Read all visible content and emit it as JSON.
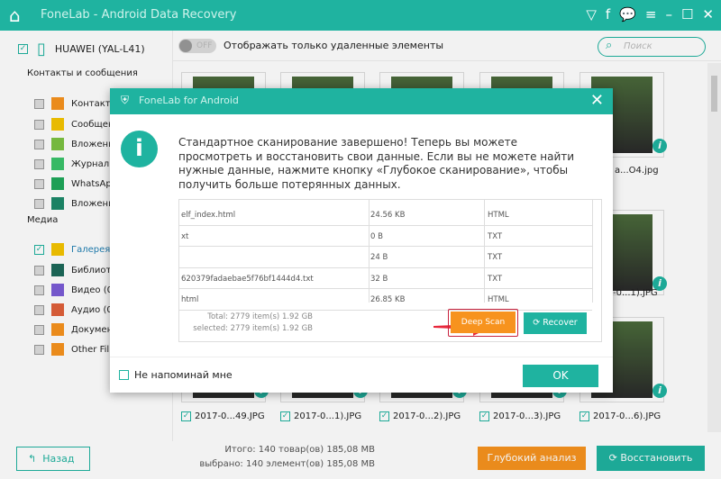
{
  "app": {
    "title": "FoneLab - Android Data Recovery"
  },
  "device": {
    "name": "HUAWEI (YAL-L41)"
  },
  "sidebar": {
    "sections": [
      {
        "label": "Контакты и сообщения"
      },
      {
        "label": "Медиа"
      }
    ],
    "items": [
      {
        "label": "Контакты",
        "color": "#f7931e"
      },
      {
        "label": "Сообщения",
        "color": "#f5c400"
      },
      {
        "label": "Вложения",
        "color": "#7cc242"
      },
      {
        "label": "Журналы",
        "color": "#3ac36b"
      },
      {
        "label": "WhatsApp",
        "color": "#1fa85a"
      },
      {
        "label": "Вложения",
        "color": "#1d8a6a"
      },
      {
        "label": "Галерея",
        "color": "#f5c400"
      },
      {
        "label": "Библиот",
        "color": "#1d6a5a"
      },
      {
        "label": "Видео (0",
        "color": "#7b5cd6"
      },
      {
        "label": "Аудио (0",
        "color": "#e0603a"
      },
      {
        "label": "Докумен",
        "color": "#f7931e"
      },
      {
        "label": "Other Fil",
        "color": "#f7931e"
      }
    ]
  },
  "topbar": {
    "toggle": "OFF",
    "toggle_label": "Отображать только удаленные элементы",
    "search_placeholder": "Поиск"
  },
  "gallery": {
    "labels": [
      "a...O4.jpg",
      "-0...1).JPG",
      "2017-0...49.JPG",
      "2017-0...1).JPG",
      "2017-0...2).JPG",
      "2017-0...3).JPG",
      "2017-0...6).JPG"
    ]
  },
  "bottom": {
    "back": "Назад",
    "total": "Итого: 140 товар(ов) 185,08 MB",
    "selected": "выбрано: 140 элемент(ов) 185,08 MB",
    "deep": "Глубокий анализ",
    "restore": "Восстановить"
  },
  "dialog": {
    "title": "FoneLab for Android",
    "message": "Стандартное сканирование завершено! Теперь вы можете просмотреть и восстановить свои данные. Если вы не можете найти нужные данные, нажмите кнопку «Глубокое сканирование», чтобы получить больше потерянных данных.",
    "rows": [
      {
        "name": "elf_index.html",
        "size": "24.56 KB",
        "type": "HTML"
      },
      {
        "name": "xt",
        "size": "0 B",
        "type": "TXT"
      },
      {
        "name": "",
        "size": "24 B",
        "type": "TXT"
      },
      {
        "name": "620379fadaebae5f76bf1444d4.txt",
        "size": "32 B",
        "type": "TXT"
      },
      {
        "name": "html",
        "size": "26.85 KB",
        "type": "HTML"
      }
    ],
    "total": "Total: 2779 item(s) 1.92 GB",
    "selected": "selected: 2779 item(s) 1.92 GB",
    "deep_scan": "Deep Scan",
    "recover": "Recover",
    "remind": "Не напоминай мне",
    "ok": "OK"
  }
}
